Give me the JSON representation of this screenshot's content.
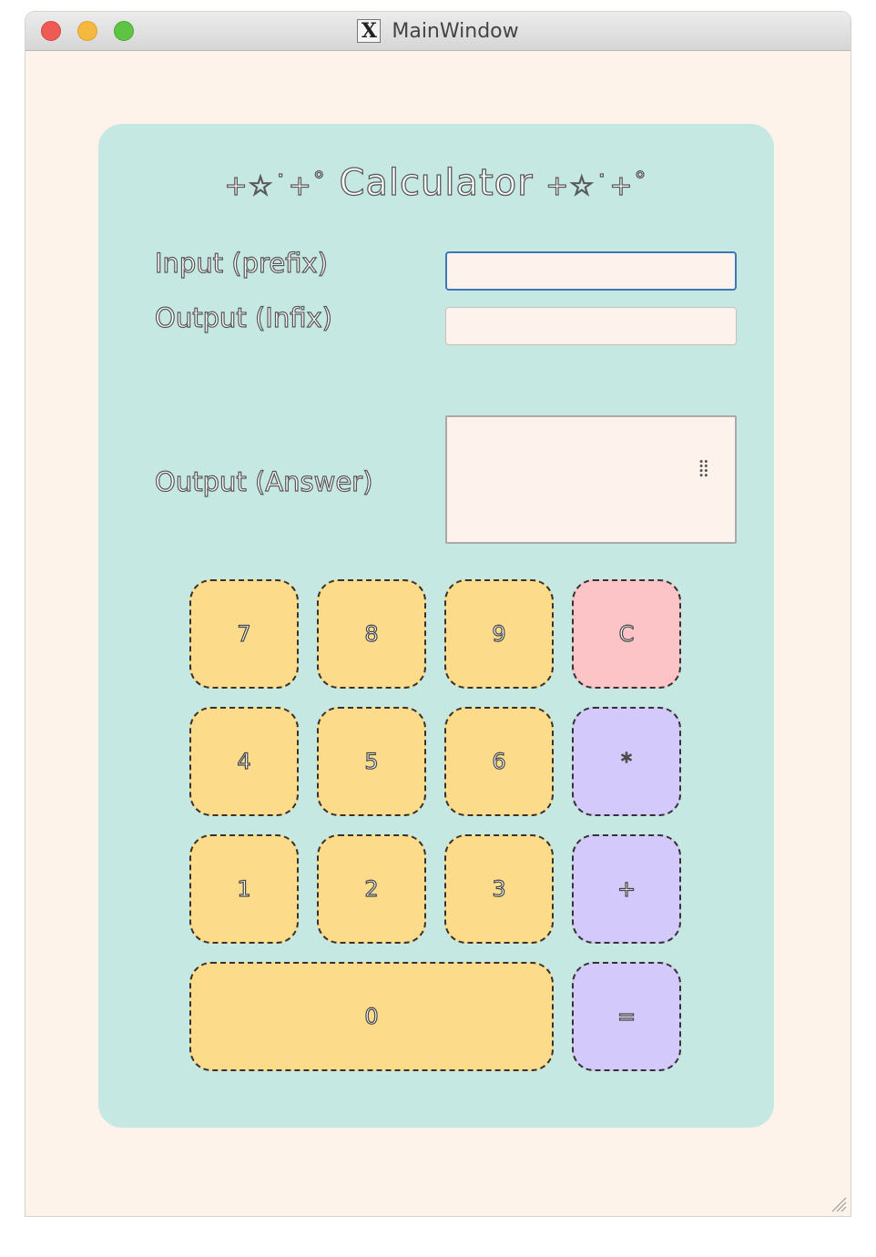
{
  "window": {
    "title": "MainWindow"
  },
  "calculator": {
    "title": "Calculator",
    "title_decoration": "+☆˙+˚",
    "labels": {
      "input": "Input (prefix)",
      "infix": "Output (Infix)",
      "answer": "Output (Answer)"
    },
    "input_value": "",
    "infix_value": "",
    "answer_value": "",
    "buttons": [
      {
        "label": "7",
        "kind": "digit"
      },
      {
        "label": "8",
        "kind": "digit"
      },
      {
        "label": "9",
        "kind": "digit"
      },
      {
        "label": "C",
        "kind": "clear"
      },
      {
        "label": "4",
        "kind": "digit"
      },
      {
        "label": "5",
        "kind": "digit"
      },
      {
        "label": "6",
        "kind": "digit"
      },
      {
        "label": "*",
        "kind": "operator"
      },
      {
        "label": "1",
        "kind": "digit"
      },
      {
        "label": "2",
        "kind": "digit"
      },
      {
        "label": "3",
        "kind": "digit"
      },
      {
        "label": "+",
        "kind": "operator"
      },
      {
        "label": "0",
        "kind": "digit"
      },
      {
        "label": "=",
        "kind": "operator"
      }
    ]
  },
  "colors": {
    "background": "#fdf3eb",
    "card": "#c5e8e2",
    "digit_button": "#fcdc8b",
    "clear_button": "#fcc4c7",
    "operator_button": "#d3c9fb",
    "focus_border": "#3b78b5"
  }
}
